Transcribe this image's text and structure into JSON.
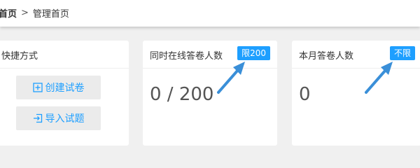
{
  "breadcrumb": {
    "home": "首页",
    "separator": ">",
    "current": "管理首页"
  },
  "quick": {
    "title": "快捷方式",
    "create_label": "创建试卷",
    "create_icon": "plus-square-icon",
    "import_label": "导入试题",
    "import_icon": "import-icon"
  },
  "concurrent": {
    "title": "同时在线答卷人数",
    "badge": "限200",
    "value": "0 / 200"
  },
  "monthly": {
    "title": "本月答卷人数",
    "badge": "不限",
    "value": "0"
  },
  "colors": {
    "accent": "#1e9fff",
    "background": "#f0f0f0",
    "button_bg": "#ebebeb"
  }
}
